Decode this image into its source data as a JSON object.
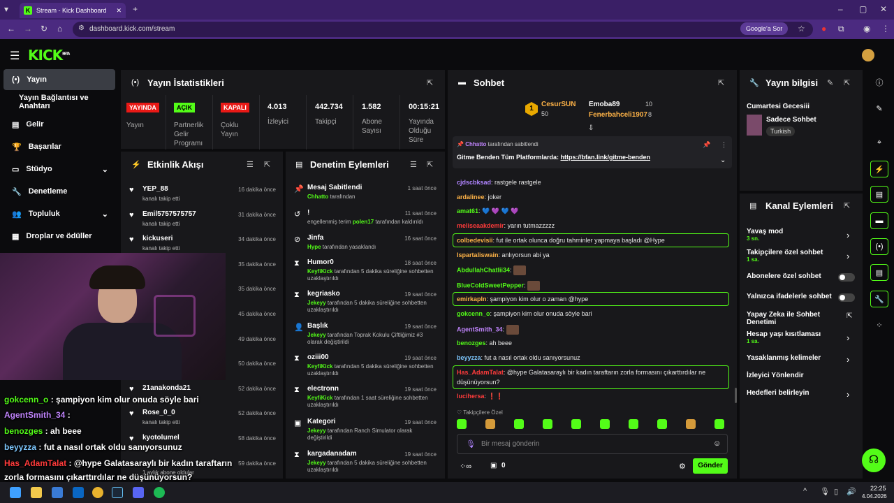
{
  "browser": {
    "tab_title": "Stream - Kick Dashboard",
    "url": "dashboard.kick.com/stream",
    "google_pill": "Google'a Sor"
  },
  "app": {
    "logo": "KICK",
    "logo_sup": "BETA"
  },
  "sidebar": {
    "items": [
      {
        "label": "Yayın",
        "icon": "broadcast-icon"
      },
      {
        "label": "Yayın Bağlantısı ve Anahtarı",
        "icon": ""
      },
      {
        "label": "Gelir",
        "icon": "dollar-icon"
      },
      {
        "label": "Başarılar",
        "icon": "trophy-icon"
      },
      {
        "label": "Stüdyo",
        "icon": "studio-icon"
      },
      {
        "label": "Denetleme",
        "icon": "wrench-icon"
      },
      {
        "label": "Topluluk",
        "icon": "people-icon"
      },
      {
        "label": "Droplar ve ödüller",
        "icon": "gift-icon"
      }
    ]
  },
  "stats": {
    "title": "Yayın İstatistikleri",
    "items": [
      {
        "badge": "YAYINDA",
        "label": "Yayın",
        "color": "#e91916"
      },
      {
        "badge": "AÇIK",
        "label": "Partnerlik Gelir Programı",
        "color": "#53fc18"
      },
      {
        "badge": "KAPALI",
        "label": "Çoklu Yayın",
        "color": "#e91916"
      },
      {
        "value": "4.013",
        "label": "İzleyici"
      },
      {
        "value": "442.734",
        "label": "Takipçi"
      },
      {
        "value": "1.582",
        "label": "Abone Sayısı"
      },
      {
        "value": "00:15:21",
        "label": "Yayında Olduğu Süre"
      }
    ]
  },
  "activity": {
    "title": "Etkinlik Akışı",
    "rows": [
      {
        "name": "YEP_88",
        "sub": "kanalı takip etti",
        "time": "16 dakika önce"
      },
      {
        "name": "Emil5757575757",
        "sub": "kanalı takip etti",
        "time": "31 dakika önce"
      },
      {
        "name": "kickuseri",
        "sub": "kanalı takip etti",
        "time": "34 dakika önce"
      },
      {
        "name": "",
        "sub": "",
        "time": "35 dakika önce"
      },
      {
        "name": "",
        "sub": "",
        "time": "35 dakika önce"
      },
      {
        "name": "",
        "sub": "",
        "time": "45 dakika önce"
      },
      {
        "name": "",
        "sub": "",
        "time": "49 dakika önce"
      },
      {
        "name": "",
        "sub": "",
        "time": "50 dakika önce"
      },
      {
        "name": "21anakonda21",
        "sub": "",
        "time": "52 dakika önce"
      },
      {
        "name": "Rose_0_0",
        "sub": "kanalı takip etti",
        "time": "52 dakika önce"
      },
      {
        "name": "kyotolumel",
        "sub": "",
        "time": "58 dakika önce"
      },
      {
        "name": "",
        "sub": "1 aylık abone oldular",
        "time": "59 dakika önce"
      }
    ]
  },
  "moderation": {
    "title": "Denetim Eylemleri",
    "rows": [
      {
        "icon": "pin-icon",
        "name": "Mesaj Sabitlendi",
        "user": "Chhatto",
        "rest": " tarafından",
        "time": "1 saat önce"
      },
      {
        "icon": "undo-icon",
        "name": "!",
        "pre": "engellenmiş terim ",
        "user": "polen17",
        "rest": " tarafından kaldırıldı",
        "time": "11 saat önce"
      },
      {
        "icon": "ban-icon",
        "name": "Jinfa",
        "user": "Hype",
        "rest": " tarafından yasaklandı",
        "time": "16 saat önce"
      },
      {
        "icon": "hourglass-icon",
        "name": "Humor0",
        "user": "KeyfiKick",
        "rest": " tarafından 5 dakika süreliğine sohbetten uzaklaştırıldı",
        "time": "18 saat önce"
      },
      {
        "icon": "hourglass-icon",
        "name": "kegriasko",
        "user": "Jekeyy",
        "rest": " tarafından 5 dakika süreliğine sohbetten uzaklaştırıldı",
        "time": "19 saat önce"
      },
      {
        "icon": "title-icon",
        "name": "Başlık",
        "user": "Jekeyy",
        "rest": " tarafından Toprak Kokulu Çiftliğimiz #3 olarak değiştirildi",
        "time": "19 saat önce"
      },
      {
        "icon": "hourglass-icon",
        "name": "oziii00",
        "user": "KeyfiKick",
        "rest": " tarafından 5 dakika süreliğine sohbetten uzaklaştırıldı",
        "time": "19 saat önce"
      },
      {
        "icon": "hourglass-icon",
        "name": "electronn",
        "user": "KeyfiKick",
        "rest": " tarafından 1 saat süreliğine sohbetten uzaklaştırıldı",
        "time": "19 saat önce"
      },
      {
        "icon": "category-icon",
        "name": "Kategori",
        "user": "Jekeyy",
        "rest": " tarafından Ranch Simulator olarak değiştirildi",
        "time": "19 saat önce"
      },
      {
        "icon": "hourglass-icon",
        "name": "kargadanadam",
        "user": "Jekeyy",
        "rest": " tarafından 5 dakika süreliğine sohbetten uzaklaştırıldı",
        "time": "19 saat önce"
      }
    ]
  },
  "chat": {
    "title": "Sohbet",
    "top": [
      {
        "rank": "1",
        "name": "CesurSUN",
        "amount": "50"
      },
      {
        "name": "Emoba89",
        "amount": "10"
      },
      {
        "name": "Fenerbahceli1907",
        "amount": "8"
      }
    ],
    "pinned": {
      "by": "Chhatto",
      "by_rest": " tarafından sabitlendi",
      "text": "Gitme Benden Tüm Platformlarda: ",
      "link": "https://bfan.link/gitme-benden"
    },
    "messages": [
      {
        "user": "cjdscbksad",
        "color": "#b084ff",
        "text": "rastgele rastgele"
      },
      {
        "user": "ardalinee",
        "color": "#ffb347",
        "text": "joker"
      },
      {
        "user": "amat61",
        "color": "#53fc18",
        "text": "💙 💜 💙 💜"
      },
      {
        "user": "meliseaakdemir",
        "color": "#ff3b3b",
        "text": "yarın tutmazzzzz"
      },
      {
        "user": "colbedevisii",
        "color": "#ffb347",
        "text": "fut ile ortak olunca doğru tahminler yapmaya başladı @Hype",
        "boxed": true
      },
      {
        "user": "Ispartaliswain",
        "color": "#ffb347",
        "text": "anlıyorsun abi ya"
      },
      {
        "user": "AbdullahChatlii34",
        "color": "#53fc18",
        "text": ""
      },
      {
        "user": "BlueColdSweetPepper",
        "color": "#53fc18",
        "text": ""
      },
      {
        "user": "emirkapln",
        "color": "#ffb347",
        "text": "şampiyon kim olur o zaman @hype",
        "boxed": true
      },
      {
        "user": "gokcenn_o",
        "color": "#53fc18",
        "text": "şampiyon kim olur onuda söyle bari"
      },
      {
        "user": "AgentSmith_34",
        "color": "#c084fc",
        "text": ""
      },
      {
        "user": "benozges",
        "color": "#53fc18",
        "text": "ah beee"
      },
      {
        "user": "beyyzza",
        "color": "#7ec8ff",
        "text": "fut a nasıl ortak oldu sanıyorsunuz"
      },
      {
        "user": "Has_AdamTalat",
        "color": "#ff3b3b",
        "text": "@hype Galatasaraylı bir kadın taraftarın zorla formasını çıkarttırdılar ne düşünüyorsun?",
        "boxed": true
      },
      {
        "user": "lucihersa",
        "color": "#ff3b3b",
        "text": "❗❗"
      }
    ],
    "followers_only_label": "Takipçilere Özel",
    "input_placeholder": "Bir mesaj gönderin",
    "count": "0",
    "send_label": "Gönder"
  },
  "stream_info": {
    "title": "Yayın bilgisi",
    "day": "Cumartesi Gecesiii",
    "category": "Sadece Sohbet",
    "language": "Turkish"
  },
  "channel_actions": {
    "title": "Kanal Eylemleri",
    "items": [
      {
        "label": "Yavaş mod",
        "value": "3 sn.",
        "control": "chevron"
      },
      {
        "label": "Takipçilere özel sohbet",
        "value": "1 sa.",
        "control": "chevron"
      },
      {
        "label": "Abonelere özel sohbet",
        "value": "",
        "control": "toggle"
      },
      {
        "label": "Yalnızca ifadelerle sohbet",
        "value": "",
        "control": "toggle"
      },
      {
        "label": "Yapay Zeka ile Sohbet Denetimi",
        "value": "",
        "control": "external"
      },
      {
        "label": "Hesap yaşı kısıtlaması",
        "value": "1 sa.",
        "control": "chevron"
      },
      {
        "label": "Yasaklanmış kelimeler",
        "value": "",
        "control": "chevron"
      },
      {
        "label": "İzleyici Yönlendir",
        "value": "",
        "control": "none"
      },
      {
        "label": "Hedefleri belirleyin",
        "value": "",
        "control": "chevron"
      }
    ]
  },
  "overlay": {
    "lines": [
      {
        "user": "gokcenn_o",
        "color": "#53fc18",
        "text": " : şampiyon kim olur onuda söyle bari"
      },
      {
        "user": "AgentSmith_34",
        "color": "#c084fc",
        "text": " :"
      },
      {
        "user": "benozges",
        "color": "#53fc18",
        "text": " : ah beee"
      },
      {
        "user": "beyyzza",
        "color": "#7ec8ff",
        "text": " : fut a nasıl ortak oldu sanıyorsunuz"
      },
      {
        "user": "Has_AdamTalat",
        "color": "#ff3b3b",
        "text": " : @hype Galatasaraylı bir kadın taraftarın"
      },
      {
        "user": "",
        "color": "#fff",
        "text": "zorla formasını çıkarttırdılar ne düşünüyorsun?"
      }
    ]
  },
  "taskbar": {
    "time": "22:25",
    "date": "4.04.2026"
  },
  "colors": {
    "accent": "#53fc18",
    "panel": "#18181b",
    "bg": "#0b0b0d"
  }
}
